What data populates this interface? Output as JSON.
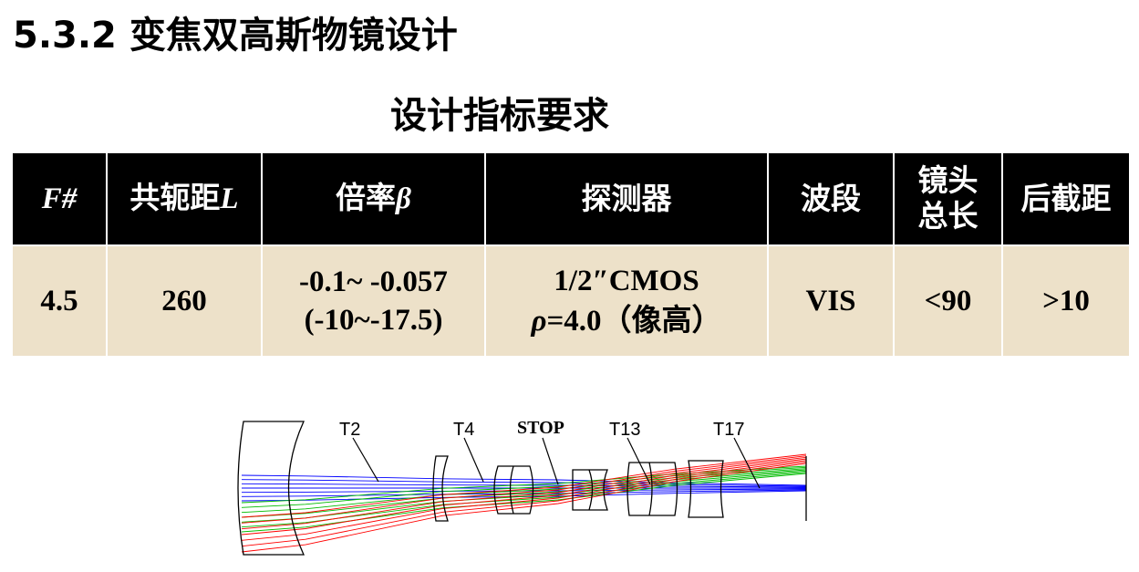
{
  "heading": "5.3.2 变焦双高斯物镜设计",
  "subheading": "设计指标要求",
  "table": {
    "headers": {
      "fnum": "F#",
      "conj_cn": "共轭距",
      "conj_sym": "L",
      "mag_cn": "倍率",
      "mag_sym": "β",
      "detector": "探测器",
      "band": "波段",
      "length_l1": "镜头",
      "length_l2": "总长",
      "bfl": "后截距"
    },
    "row": {
      "fnum": "4.5",
      "conj": "260",
      "mag_l1": "-0.1~ -0.057",
      "mag_l2": "(-10~-17.5)",
      "det_l1": "1/2″CMOS",
      "det_rho": "ρ",
      "det_eq": "=4.0",
      "det_paren": "（像高）",
      "band": "VIS",
      "length": "<90",
      "bfl": ">10"
    }
  },
  "diagram": {
    "labels": [
      "T2",
      "T4",
      "STOP",
      "T13",
      "T17"
    ],
    "ray_colors": [
      "#0000ff",
      "#00bb00",
      "#ff0000"
    ]
  }
}
